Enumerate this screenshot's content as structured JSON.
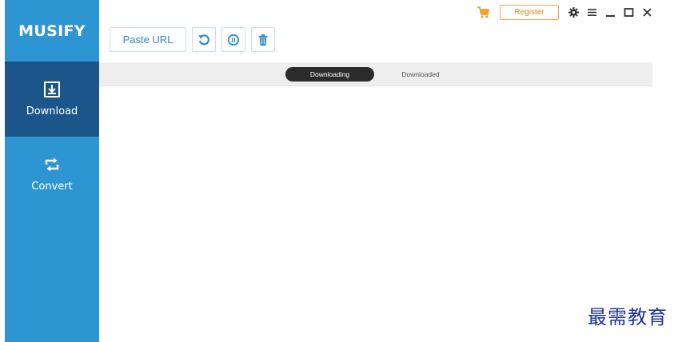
{
  "app": {
    "logo": "MUSIFY"
  },
  "sidebar": {
    "items": [
      {
        "label": "Download",
        "icon": "download-icon",
        "active": true
      },
      {
        "label": "Convert",
        "icon": "convert-icon",
        "active": false
      }
    ]
  },
  "header": {
    "register_label": "Register",
    "icons": [
      "cart-icon",
      "gear-icon",
      "menu-icon",
      "minimize-icon",
      "maximize-icon",
      "close-icon"
    ]
  },
  "toolbar": {
    "paste_url_label": "Paste URL",
    "icons": [
      "refresh-icon",
      "pause-icon",
      "delete-icon"
    ]
  },
  "tabs": [
    {
      "label": "Downloading",
      "active": true
    },
    {
      "label": "Downloaded",
      "active": false
    }
  ],
  "watermark": "最需教育",
  "colors": {
    "sidebar_bg": "#2e95d3",
    "sidebar_active": "#1c5589",
    "accent": "#2e88c8",
    "register_orange": "#f3a34b",
    "active_tab": "#2b2b2b",
    "watermark": "#1f2f9a"
  }
}
